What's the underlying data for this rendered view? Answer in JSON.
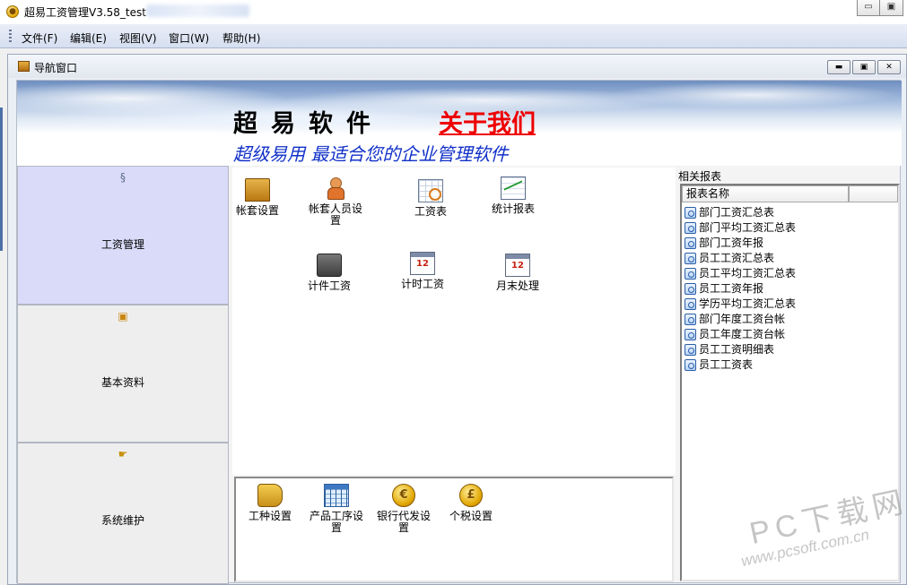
{
  "window": {
    "title": "超易工资管理V3.58_test",
    "minimize_glyph": "▭",
    "maximize_glyph": "▣"
  },
  "menu": [
    "文件(F)",
    "编辑(E)",
    "视图(V)",
    "窗口(W)",
    "帮助(H)"
  ],
  "child_window": {
    "title": "导航窗口",
    "minimize_glyph": "▬",
    "restore_glyph": "▣",
    "close_glyph": "✕"
  },
  "banner": {
    "brand": "超易软件",
    "about": "关于我们",
    "slogan": "超级易用  最适合您的企业管理软件"
  },
  "nav": [
    {
      "label": "工资管理",
      "icon": "s-scroll-icon",
      "glyph": "§",
      "active": true
    },
    {
      "label": "基本资料",
      "icon": "folder-doc-icon",
      "glyph": "▣",
      "active": false
    },
    {
      "label": "系统维护",
      "icon": "pointing-hand-icon",
      "glyph": "☛",
      "active": false
    }
  ],
  "tools_top": [
    {
      "label": "帐套设置",
      "icon": "folder-icon"
    },
    {
      "label": "帐套人员设置",
      "icon": "person-icon"
    },
    {
      "label": "工资表",
      "icon": "spreadsheet-magnifier-icon"
    },
    {
      "label": "统计报表",
      "icon": "line-chart-icon"
    },
    {
      "label": "计件工资",
      "icon": "briefcase-icon"
    },
    {
      "label": "计时工资",
      "icon": "calendar-icon"
    },
    {
      "label": "月末处理",
      "icon": "calendar-icon"
    }
  ],
  "tools_bottom": [
    {
      "label": "工种设置",
      "icon": "pointing-hand-icon"
    },
    {
      "label": "产品工序设置",
      "icon": "table-icon"
    },
    {
      "label": "银行代发设置",
      "icon": "coin-icon",
      "glyph": "€"
    },
    {
      "label": "个税设置",
      "icon": "coin-icon",
      "glyph": "£"
    }
  ],
  "reports": {
    "title": "相关报表",
    "column_header": "报表名称",
    "items": [
      "部门工资汇总表",
      "部门平均工资汇总表",
      "部门工资年报",
      "员工工资汇总表",
      "员工平均工资汇总表",
      "员工工资年报",
      "学历平均工资汇总表",
      "部门年度工资台帐",
      "员工年度工资台帐",
      "员工工资明细表",
      "员工工资表"
    ]
  },
  "watermark": {
    "main": "PC下载网",
    "url": "www.pcsoft.com.cn"
  }
}
